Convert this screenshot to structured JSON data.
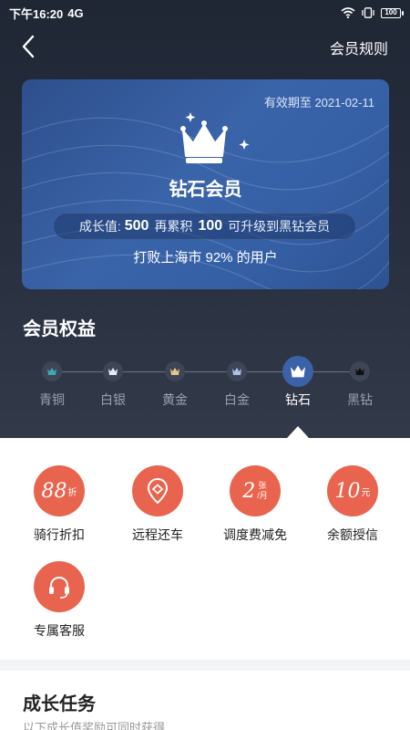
{
  "status_bar": {
    "time": "下午16:20",
    "network": "4G",
    "battery": "100"
  },
  "nav": {
    "rules": "会员规则"
  },
  "card": {
    "validity": "有效期至 2021-02-11",
    "level_name": "钻石会员",
    "growth_label": "成长值:",
    "growth_value": "500",
    "more_label": "再累积",
    "more_value": "100",
    "upgrade_text": "可升级到黑钻会员",
    "beat_text": "打败上海市 92% 的用户"
  },
  "benefits_section": {
    "title": "会员权益",
    "levels": [
      {
        "label": "青铜",
        "crown_color": "#3fa9b8"
      },
      {
        "label": "白银",
        "crown_color": "#e8ecf2"
      },
      {
        "label": "黄金",
        "crown_color": "#e6c48a"
      },
      {
        "label": "白金",
        "crown_color": "#a9c1e6"
      },
      {
        "label": "钻石",
        "crown_color": "#ffffff"
      },
      {
        "label": "黑钻",
        "crown_color": "#1a1a1a"
      }
    ],
    "active_level": "钻石"
  },
  "benefits": [
    {
      "label": "骑行折扣",
      "icon_main": "88",
      "icon_sub": "折"
    },
    {
      "label": "远程还车",
      "icon": "map-pin-icon"
    },
    {
      "label": "调度费减免",
      "icon_main": "2",
      "icon_sub_top": "张",
      "icon_sub_bottom": "/月"
    },
    {
      "label": "余额授信",
      "icon_main": "10",
      "icon_sub": "元"
    },
    {
      "label": "专属客服",
      "icon": "headset-icon"
    }
  ],
  "tasks": {
    "title": "成长任务",
    "subtitle": "以下成长值奖励可同时获得"
  },
  "colors": {
    "accent": "#e9644e",
    "card": "#3660a6",
    "header_bg": "#283040"
  }
}
